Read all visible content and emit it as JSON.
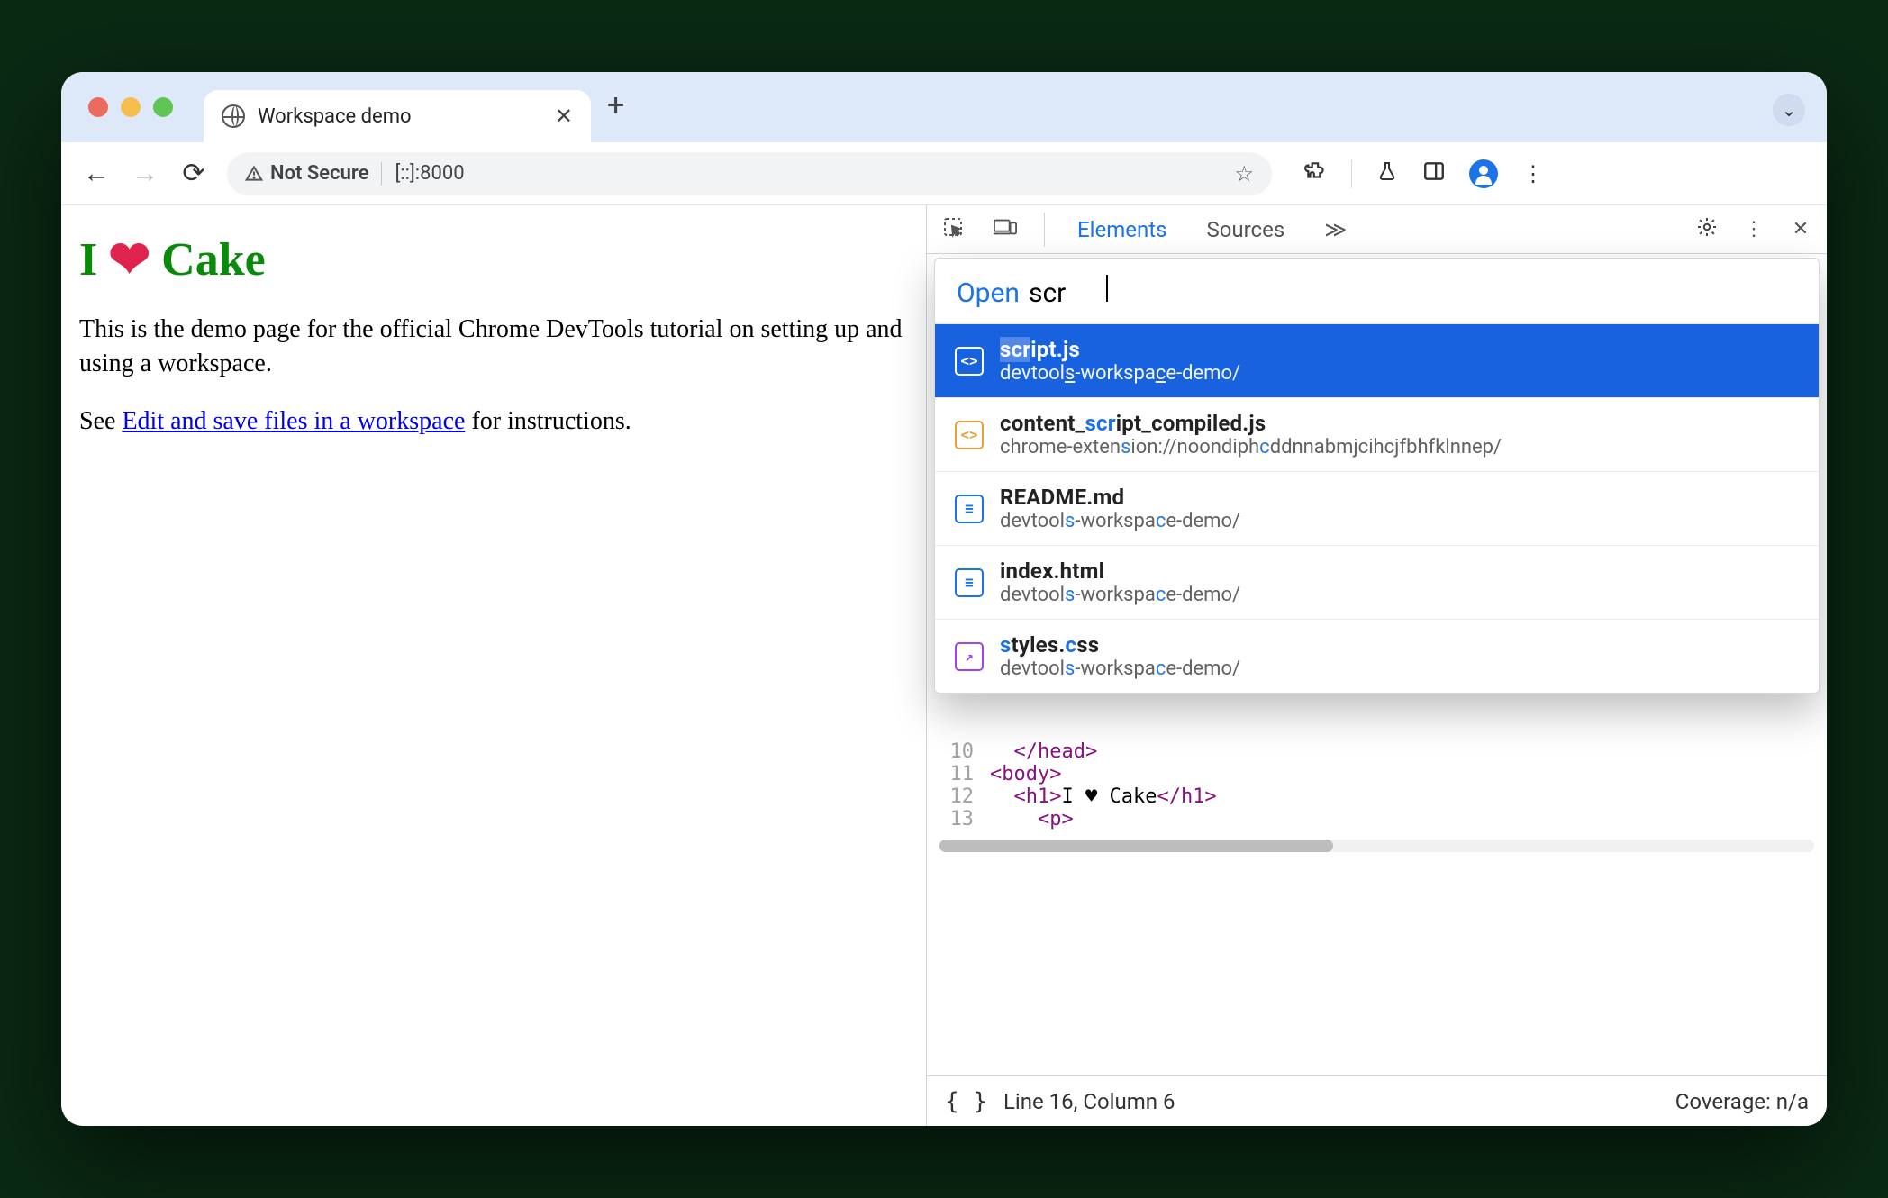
{
  "tab": {
    "title": "Workspace demo"
  },
  "omnibox": {
    "security": "Not Secure",
    "url": "[::]:8000"
  },
  "page": {
    "h1_pre": "I",
    "h1_post": "Cake",
    "para": "This is the demo page for the official Chrome DevTools tutorial on setting up and using a workspace.",
    "see_pre": "See ",
    "link": "Edit and save files in a workspace",
    "see_post": " for instructions."
  },
  "devtools": {
    "tabs": {
      "t0": "Elements",
      "t1": "Sources"
    },
    "palette": {
      "label": "Open",
      "query": "scr",
      "items": [
        {
          "name": "script.js",
          "sub": "devtools-workspace-demo/",
          "icon": "js",
          "selected": true
        },
        {
          "name": "content_script_compiled.js",
          "sub": "chrome-extension://noondiphcddnnabmjcihcjfbhfklnnep/",
          "icon": "js2",
          "selected": false
        },
        {
          "name": "README.md",
          "sub": "devtools-workspace-demo/",
          "icon": "doc",
          "selected": false
        },
        {
          "name": "index.html",
          "sub": "devtools-workspace-demo/",
          "icon": "doc",
          "selected": false
        },
        {
          "name": "styles.css",
          "sub": "devtools-workspace-demo/",
          "icon": "css",
          "selected": false
        }
      ]
    },
    "code": {
      "l10n": "10",
      "l10": "  </head>",
      "l11n": "11",
      "l11": "<body>",
      "l12n": "12",
      "l12_pre": "  <h1>",
      "l12_txt": "I ♥ Cake",
      "l12_post": "</h1>",
      "l13n": "13",
      "l13": "    <p>"
    },
    "status": {
      "pos": "Line 16, Column 6",
      "coverage": "Coverage: n/a"
    }
  }
}
